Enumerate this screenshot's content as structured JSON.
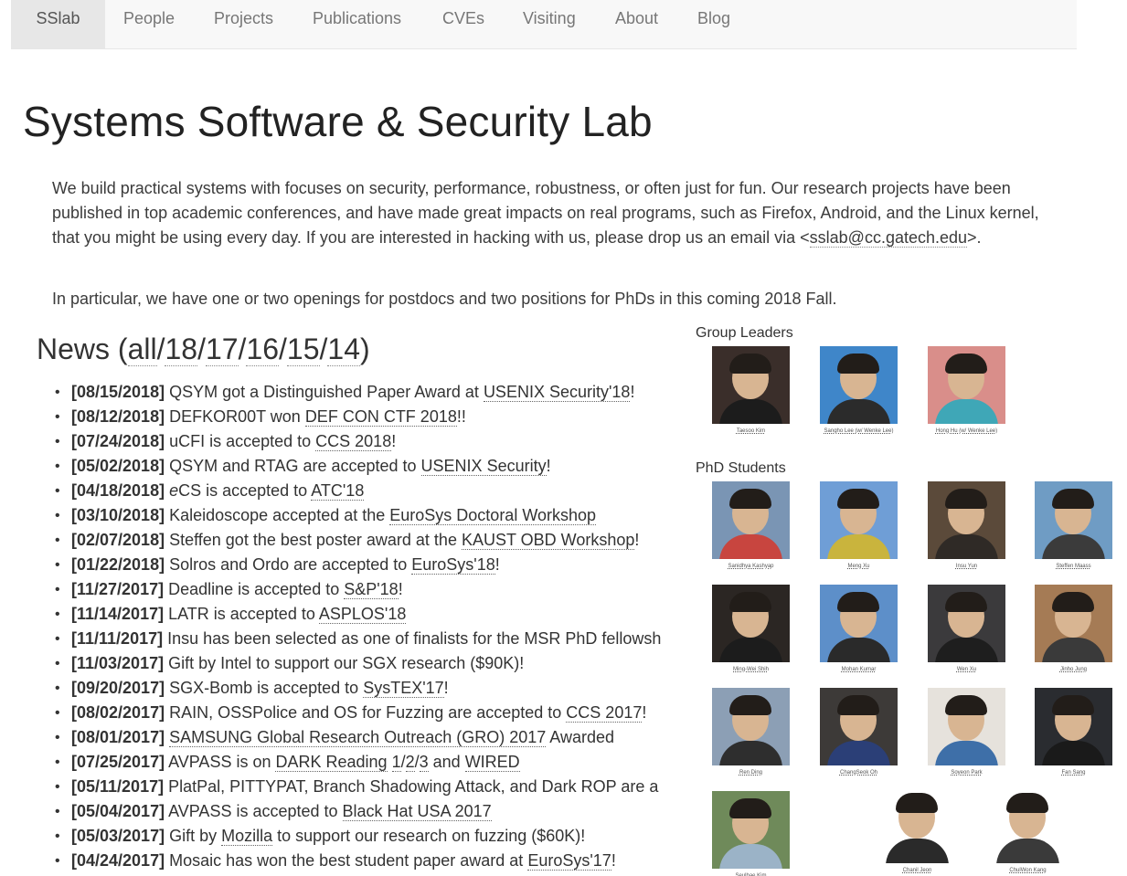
{
  "nav": {
    "items": [
      {
        "label": "SSlab",
        "active": true
      },
      {
        "label": "People",
        "active": false
      },
      {
        "label": "Projects",
        "active": false
      },
      {
        "label": "Publications",
        "active": false
      },
      {
        "label": "CVEs",
        "active": false
      },
      {
        "label": "Visiting",
        "active": false
      },
      {
        "label": "About",
        "active": false
      },
      {
        "label": "Blog",
        "active": false
      }
    ]
  },
  "header": {
    "title": "Systems Software & Security Lab"
  },
  "intro": {
    "text": "We build practical systems with focuses on security, performance, robustness, or often just for fun. Our research projects have been published in top academic conferences, and have made great impacts on real programs, such as Firefox, Android, and the Linux kernel, that you might be using every day. If you are interested in hacking with us, please drop us an email via",
    "email_prefix": "<",
    "email": "sslab@cc.gatech.edu",
    "email_suffix": ">.",
    "openings": "In particular, we have one or two openings for postdocs and two positions for PhDs in this coming 2018 Fall."
  },
  "news": {
    "heading_prefix": "News (",
    "heading_suffix": ")",
    "year_links": [
      "all",
      "18",
      "17",
      "16",
      "15",
      "14"
    ],
    "items": [
      {
        "date": "[08/15/2018]",
        "parts": [
          {
            "t": " QSYM got a Distinguished Paper Award at "
          },
          {
            "t": "USENIX Security'18",
            "link": true
          },
          {
            "t": "!"
          }
        ]
      },
      {
        "date": "[08/12/2018]",
        "parts": [
          {
            "t": " DEFKOR00T won "
          },
          {
            "t": "DEF CON CTF 2018",
            "link": true
          },
          {
            "t": "!!"
          }
        ]
      },
      {
        "date": "[07/24/2018]",
        "parts": [
          {
            "t": " uCFI is accepted to "
          },
          {
            "t": "CCS 2018",
            "link": true
          },
          {
            "t": "!"
          }
        ]
      },
      {
        "date": "[05/02/2018]",
        "parts": [
          {
            "t": " QSYM and RTAG are accepted to "
          },
          {
            "t": "USENIX Security",
            "link": true
          },
          {
            "t": "!"
          }
        ]
      },
      {
        "date": "[04/18/2018]",
        "parts": [
          {
            "t": " "
          },
          {
            "t": "e",
            "italic": true
          },
          {
            "t": "CS is accepted to "
          },
          {
            "t": "ATC'18",
            "link": true
          }
        ]
      },
      {
        "date": "[03/10/2018]",
        "parts": [
          {
            "t": " Kaleidoscope accepted at the "
          },
          {
            "t": "EuroSys Doctoral Workshop",
            "link": true
          }
        ]
      },
      {
        "date": "[02/07/2018]",
        "parts": [
          {
            "t": " Steffen got the best poster award at the "
          },
          {
            "t": "KAUST OBD Workshop",
            "link": true
          },
          {
            "t": "!"
          }
        ]
      },
      {
        "date": "[01/22/2018]",
        "parts": [
          {
            "t": " Solros and Ordo are accepted to "
          },
          {
            "t": "EuroSys'18",
            "link": true
          },
          {
            "t": "!"
          }
        ]
      },
      {
        "date": "[11/27/2017]",
        "parts": [
          {
            "t": " Deadline is accepted to "
          },
          {
            "t": "S&P'18",
            "link": true
          },
          {
            "t": "!"
          }
        ]
      },
      {
        "date": "[11/14/2017]",
        "parts": [
          {
            "t": " LATR is accepted to "
          },
          {
            "t": "ASPLOS'18",
            "link": true
          }
        ]
      },
      {
        "date": "[11/11/2017]",
        "parts": [
          {
            "t": " Insu has been selected as one of finalists for the MSR PhD fellowsh"
          }
        ]
      },
      {
        "date": "[11/03/2017]",
        "parts": [
          {
            "t": " Gift by Intel to support our SGX research ($90K)!"
          }
        ]
      },
      {
        "date": "[09/20/2017]",
        "parts": [
          {
            "t": " SGX-Bomb is accepted to "
          },
          {
            "t": "SysTEX'17",
            "link": true
          },
          {
            "t": "!"
          }
        ]
      },
      {
        "date": "[08/02/2017]",
        "parts": [
          {
            "t": " RAIN, OSSPolice and OS for Fuzzing are accepted to "
          },
          {
            "t": "CCS 2017",
            "link": true
          },
          {
            "t": "!"
          }
        ]
      },
      {
        "date": "[08/01/2017]",
        "parts": [
          {
            "t": " "
          },
          {
            "t": "SAMSUNG Global Research Outreach (GRO) 2017",
            "link": true
          },
          {
            "t": " Awarded"
          }
        ]
      },
      {
        "date": "[07/25/2017]",
        "parts": [
          {
            "t": " AVPASS is on "
          },
          {
            "t": "DARK Reading",
            "link": true
          },
          {
            "t": " "
          },
          {
            "t": "1",
            "link": true
          },
          {
            "t": "/"
          },
          {
            "t": "2",
            "link": true
          },
          {
            "t": "/"
          },
          {
            "t": "3",
            "link": true
          },
          {
            "t": " and "
          },
          {
            "t": "WIRED",
            "link": true
          }
        ]
      },
      {
        "date": "[05/11/2017]",
        "parts": [
          {
            "t": " PlatPal, PITTYPAT, Branch Shadowing Attack, and Dark ROP are a"
          }
        ]
      },
      {
        "date": "[05/04/2017]",
        "parts": [
          {
            "t": " AVPASS is accepted to "
          },
          {
            "t": "Black Hat USA 2017",
            "link": true
          }
        ]
      },
      {
        "date": "[05/03/2017]",
        "parts": [
          {
            "t": " Gift by "
          },
          {
            "t": "Mozilla",
            "link": true
          },
          {
            "t": " to support our research on fuzzing ($60K)!"
          }
        ]
      },
      {
        "date": "[04/24/2017]",
        "parts": [
          {
            "t": " Mosaic has won the best student paper award at "
          },
          {
            "t": "EuroSys'17",
            "link": true
          },
          {
            "t": "!"
          }
        ]
      }
    ]
  },
  "people": {
    "leaders_label": "Group Leaders",
    "students_label": "PhD Students",
    "leaders": [
      {
        "name": "Taesoo Kim",
        "bg": "#3a2e2a",
        "shirt": "#1c1c1c"
      },
      {
        "name": "Sangho Lee (w/ Wenke Lee)",
        "bg": "#3f86c9",
        "shirt": "#2b2b2b"
      },
      {
        "name": "Hong Hu (w/ Wenke Lee)",
        "bg": "#d98e8a",
        "shirt": "#3fa7b7"
      }
    ],
    "students": [
      {
        "name": "Sanidhya Kashyap",
        "bg": "#7a95b4",
        "shirt": "#c8453f"
      },
      {
        "name": "Meng Xu",
        "bg": "#6f9ed6",
        "shirt": "#c9b43d"
      },
      {
        "name": "Insu Yun",
        "bg": "#5b4a3a",
        "shirt": "#2f2a26"
      },
      {
        "name": "Steffen Maass",
        "bg": "#6f9cc4",
        "shirt": "#3b3b3b"
      },
      {
        "name": "Ming-Wei Shih",
        "bg": "#2b2623",
        "shirt": "#1c1c1c"
      },
      {
        "name": "Mohan Kumar",
        "bg": "#5d8fc9",
        "shirt": "#2a2a2a"
      },
      {
        "name": "Wen Xu",
        "bg": "#3b3a3c",
        "shirt": "#1e1e1e"
      },
      {
        "name": "Jinho Jung",
        "bg": "#a57b55",
        "shirt": "#3a3a3a"
      },
      {
        "name": "Ren Ding",
        "bg": "#8c9fb5",
        "shirt": "#2e2e2e"
      },
      {
        "name": "ChangSeok Oh",
        "bg": "#3d3a38",
        "shirt": "#2b3f77"
      },
      {
        "name": "Soyeon Park",
        "bg": "#e6e2dc",
        "shirt": "#3e6fa8"
      },
      {
        "name": "Fan Sang",
        "bg": "#2a2c30",
        "shirt": "#1a1a1a"
      },
      {
        "name": "Seulbae Kim",
        "bg": "#6f8a5a",
        "shirt": "#9bb3c7"
      },
      {
        "name": "Chanil Jeon",
        "bg": "#ffffff",
        "shirt": "#2a2a2a"
      },
      {
        "name": "ChulWon Kang",
        "bg": "#ffffff",
        "shirt": "#3a3a3a"
      }
    ]
  }
}
